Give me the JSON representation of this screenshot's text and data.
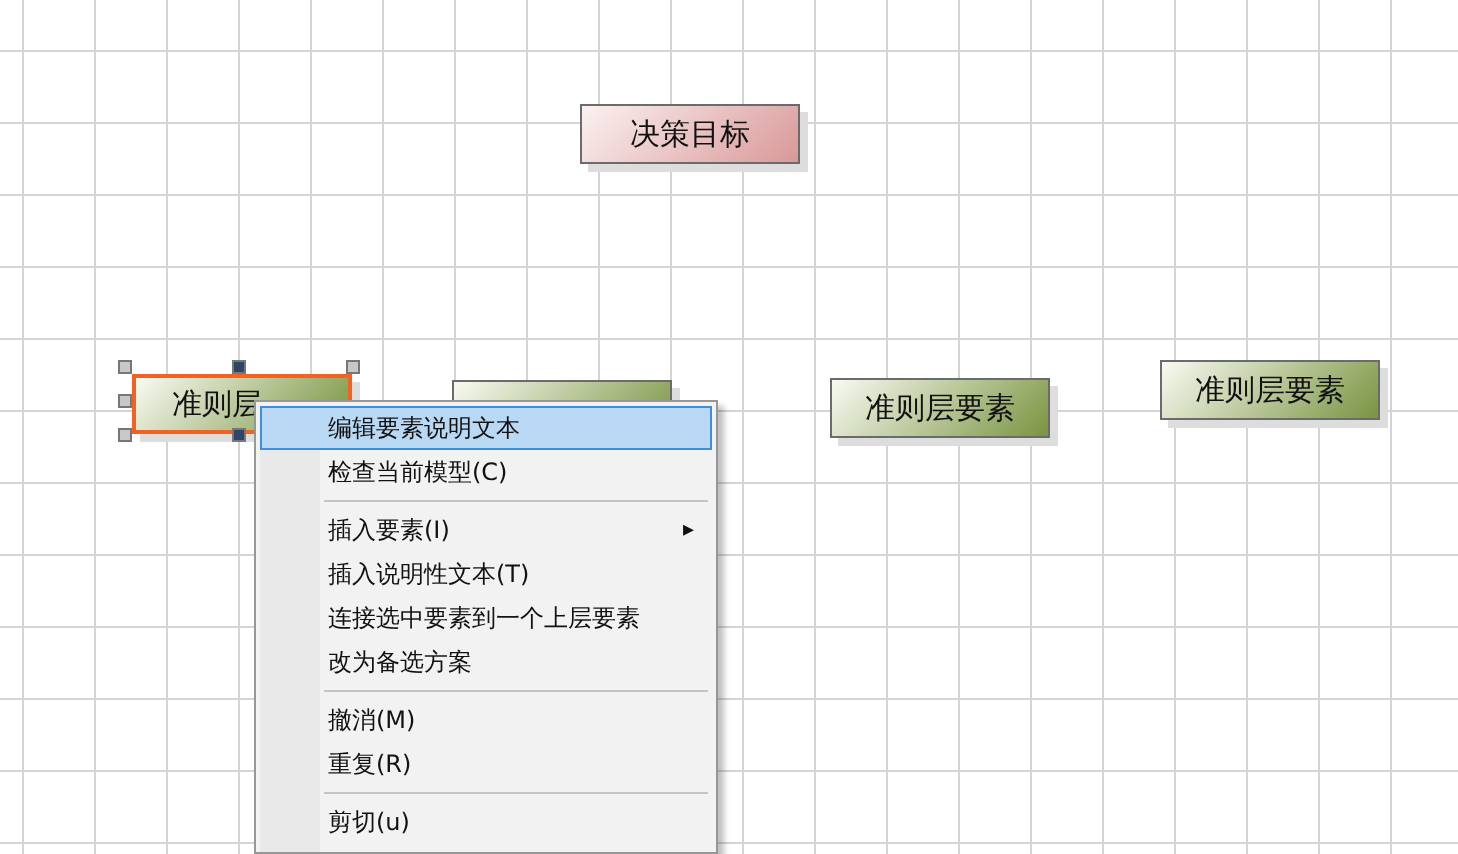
{
  "canvas": {
    "nodes": [
      {
        "label": "决策目标",
        "kind": "goal",
        "selected": false
      },
      {
        "label": "准则层",
        "kind": "criterion",
        "selected": true
      },
      {
        "kind": "criterion",
        "selected": false
      },
      {
        "label": "准则层要素",
        "kind": "criterion",
        "selected": false
      },
      {
        "label": "准则层要素",
        "kind": "criterion",
        "selected": false
      }
    ]
  },
  "context_menu": {
    "items": [
      {
        "kind": "item",
        "label": "编辑要素说明文本",
        "selected": true
      },
      {
        "kind": "item",
        "label": "检查当前模型(C)",
        "selected": false
      },
      {
        "kind": "separator"
      },
      {
        "kind": "submenu",
        "label": "插入要素(I)",
        "selected": false,
        "arrow": "▸"
      },
      {
        "kind": "item",
        "label": "插入说明性文本(T)",
        "selected": false
      },
      {
        "kind": "item",
        "label": "连接选中要素到一个上层要素",
        "selected": false
      },
      {
        "kind": "item",
        "label": "改为备选方案",
        "selected": false
      },
      {
        "kind": "separator"
      },
      {
        "kind": "item",
        "label": "撤消(M)",
        "selected": false
      },
      {
        "kind": "item",
        "label": "重复(R)",
        "selected": false
      },
      {
        "kind": "separator"
      },
      {
        "kind": "item",
        "label": "剪切(u)",
        "selected": false
      }
    ]
  }
}
